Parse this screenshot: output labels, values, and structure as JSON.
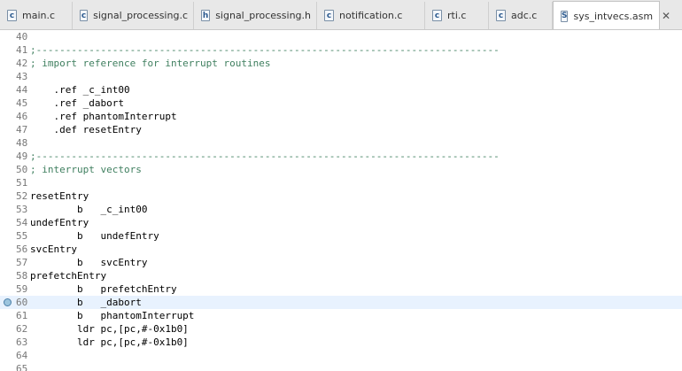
{
  "tabs": [
    {
      "icon": "c",
      "label": "main.c",
      "active": false
    },
    {
      "icon": "c",
      "label": "signal_processing.c",
      "active": false
    },
    {
      "icon": "h",
      "label": "signal_processing.h",
      "active": false
    },
    {
      "icon": "c",
      "label": "notification.c",
      "active": false
    },
    {
      "icon": "c",
      "label": "rti.c",
      "active": false
    },
    {
      "icon": "c",
      "label": "adc.c",
      "active": false
    },
    {
      "icon": "S",
      "label": "sys_intvecs.asm",
      "active": true,
      "close": "✕"
    }
  ],
  "editor": {
    "current_line": 60,
    "breakpoint_line": 60,
    "lines": [
      {
        "n": "40",
        "code": "",
        "kind": "code"
      },
      {
        "n": "41",
        "code": ";-------------------------------------------------------------------------------",
        "kind": "comment"
      },
      {
        "n": "42",
        "code": "; import reference for interrupt routines",
        "kind": "comment"
      },
      {
        "n": "43",
        "code": "",
        "kind": "code"
      },
      {
        "n": "44",
        "code": "    .ref _c_int00",
        "kind": "code"
      },
      {
        "n": "45",
        "code": "    .ref _dabort",
        "kind": "code"
      },
      {
        "n": "46",
        "code": "    .ref phantomInterrupt",
        "kind": "code"
      },
      {
        "n": "47",
        "code": "    .def resetEntry",
        "kind": "code"
      },
      {
        "n": "48",
        "code": "",
        "kind": "code"
      },
      {
        "n": "49",
        "code": ";-------------------------------------------------------------------------------",
        "kind": "comment"
      },
      {
        "n": "50",
        "code": "; interrupt vectors",
        "kind": "comment"
      },
      {
        "n": "51",
        "code": "",
        "kind": "code"
      },
      {
        "n": "52",
        "code": "resetEntry",
        "kind": "code"
      },
      {
        "n": "53",
        "code": "        b   _c_int00",
        "kind": "code"
      },
      {
        "n": "54",
        "code": "undefEntry",
        "kind": "code"
      },
      {
        "n": "55",
        "code": "        b   undefEntry",
        "kind": "code"
      },
      {
        "n": "56",
        "code": "svcEntry",
        "kind": "code"
      },
      {
        "n": "57",
        "code": "        b   svcEntry",
        "kind": "code"
      },
      {
        "n": "58",
        "code": "prefetchEntry",
        "kind": "code"
      },
      {
        "n": "59",
        "code": "        b   prefetchEntry",
        "kind": "code"
      },
      {
        "n": "60",
        "code": "        b   _dabort",
        "kind": "code"
      },
      {
        "n": "61",
        "code": "        b   phantomInterrupt",
        "kind": "code"
      },
      {
        "n": "62",
        "code": "        ldr pc,[pc,#-0x1b0]",
        "kind": "code"
      },
      {
        "n": "63",
        "code": "        ldr pc,[pc,#-0x1b0]",
        "kind": "code"
      },
      {
        "n": "64",
        "code": "",
        "kind": "code"
      },
      {
        "n": "65",
        "code": "",
        "kind": "code"
      }
    ]
  }
}
